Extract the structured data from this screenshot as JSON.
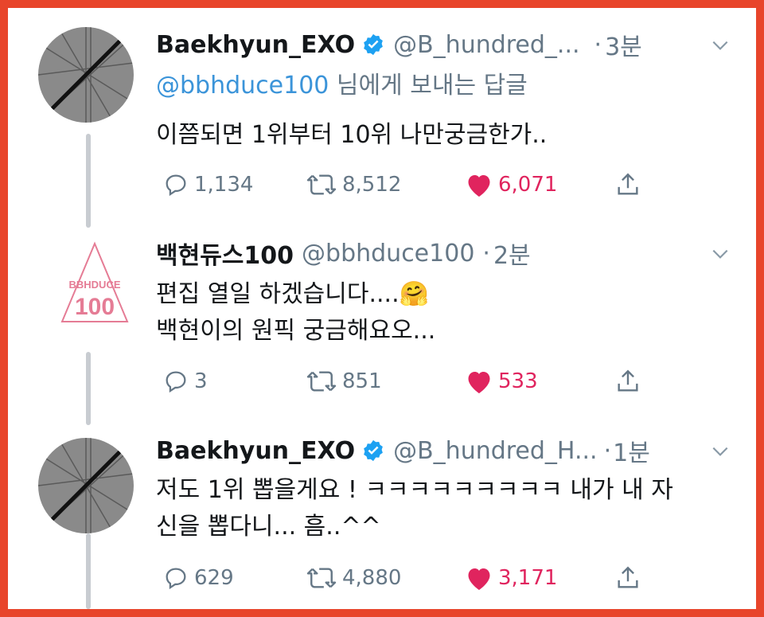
{
  "tweets": [
    {
      "name": "Baekhyun_EXO",
      "handle": "@B_hundred_...",
      "time": "3분",
      "reply_mention": "@bbhduce100",
      "reply_suffix": " 님에게 보내는 답글",
      "lines": [
        "이쯤되면 1위부터 10위 나만궁금한가.."
      ],
      "replies": "1,134",
      "retweets": "8,512",
      "likes": "6,071"
    },
    {
      "name": "백현듀스100",
      "handle": "@bbhduce100",
      "time": "2분",
      "lines": [
        "편집 열일 하겠습니다....🤗",
        "백현이의 원픽 궁금해요오..."
      ],
      "replies": "3",
      "retweets": "851",
      "likes": "533",
      "logo_text_top": "BBHDUCE",
      "logo_text_num": "100"
    },
    {
      "name": "Baekhyun_EXO",
      "handle": "@B_hundred_H...",
      "time": "1분",
      "lines": [
        "저도 1위 뽑을게요 ! ㅋㅋㅋㅋㅋㅋㅋㅋㅋ 내가 내 자",
        "신을 뽑다니... 흠..^^"
      ],
      "replies": "629",
      "retweets": "4,880",
      "likes": "3,171"
    }
  ],
  "icons": {
    "verified": "verified-badge-icon",
    "reply": "reply-icon",
    "retweet": "retweet-icon",
    "like": "heart-icon",
    "share": "share-icon",
    "menu": "chevron-down-icon"
  },
  "colors": {
    "border": "#E8452B",
    "link": "#3b94d9",
    "muted": "#657786",
    "like": "#e0245e",
    "verified": "#1da1f2"
  }
}
